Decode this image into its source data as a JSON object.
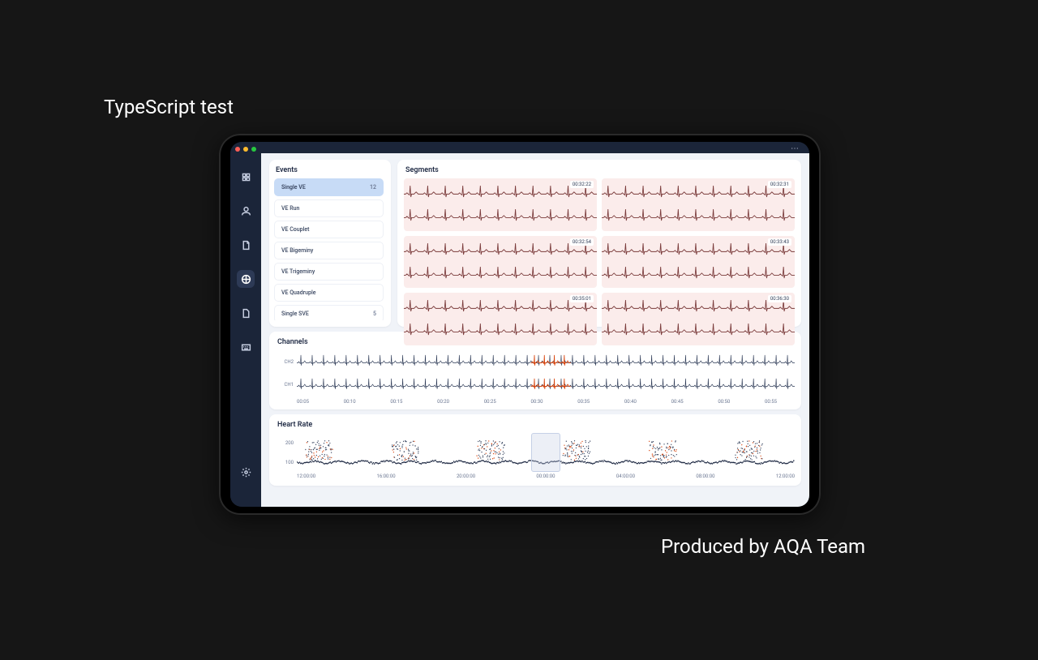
{
  "captions": {
    "top": "TypeScript test",
    "bottom": "Produced by AQA Team"
  },
  "sidebar": {
    "items": [
      {
        "name": "dashboard-icon",
        "active": false
      },
      {
        "name": "patient-icon",
        "active": false
      },
      {
        "name": "report-icon",
        "active": false
      },
      {
        "name": "analysis-icon",
        "active": true
      },
      {
        "name": "file-icon",
        "active": false
      },
      {
        "name": "keyboard-icon",
        "active": false
      }
    ],
    "footer": {
      "name": "settings-icon"
    }
  },
  "panels": {
    "events": {
      "title": "Events",
      "items": [
        {
          "label": "Single VE",
          "count": "12",
          "selected": true
        },
        {
          "label": "VE Run",
          "count": "",
          "selected": false
        },
        {
          "label": "VE Couplet",
          "count": "",
          "selected": false
        },
        {
          "label": "VE Bigeminy",
          "count": "",
          "selected": false
        },
        {
          "label": "VE Trigeminy",
          "count": "",
          "selected": false
        },
        {
          "label": "VE Quadruple",
          "count": "",
          "selected": false
        },
        {
          "label": "Single SVE",
          "count": "5",
          "selected": false
        }
      ]
    },
    "segments": {
      "title": "Segments",
      "items": [
        {
          "ts": "00:32:22"
        },
        {
          "ts": "00:32:31"
        },
        {
          "ts": "00:32:54"
        },
        {
          "ts": "00:33:43"
        },
        {
          "ts": "00:35:01"
        },
        {
          "ts": "00:36:30"
        }
      ]
    },
    "channels": {
      "title": "Channels",
      "chs": [
        "CH2",
        "CH1"
      ],
      "ticks": [
        "00:05",
        "00:10",
        "00:15",
        "00:20",
        "00:25",
        "00:30",
        "00:35",
        "00:40",
        "00:45",
        "00:50",
        "00:55"
      ],
      "highlight": {
        "from": 0.47,
        "to": 0.55
      }
    },
    "heartrate": {
      "title": "Heart Rate",
      "y": [
        "200",
        "100"
      ],
      "x": [
        "12:00:00",
        "16:00:00",
        "20:00:00",
        "00:00:00",
        "04:00:00",
        "08:00:00",
        "12:00:00"
      ],
      "sel": {
        "from": 0.47,
        "to": 0.53
      }
    }
  }
}
